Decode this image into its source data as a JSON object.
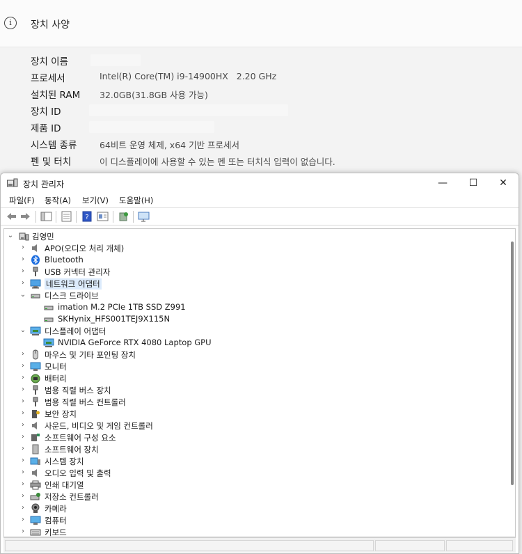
{
  "settings": {
    "spec_section_title": "장치 사양",
    "rows": [
      {
        "label": "장치 이름",
        "value": ""
      },
      {
        "label": "프로세서",
        "value": "Intel(R) Core(TM) i9-14900HX   2.20 GHz"
      },
      {
        "label": "설치된 RAM",
        "value": "32.0GB(31.8GB 사용 가능)"
      },
      {
        "label": "장치 ID",
        "value": ""
      },
      {
        "label": "제품 ID",
        "value": ""
      },
      {
        "label": "시스템 종류",
        "value": "64비트 운영 체제, x64 기반 프로세서"
      },
      {
        "label": "펜 및 터치",
        "value": "이 디스플레이에 사용할 수 있는 펜 또는 터치식 입력이 없습니다."
      }
    ]
  },
  "window": {
    "title": "장치 관리자",
    "minimize": "—",
    "maximize": "☐",
    "close": "✕"
  },
  "menu": [
    "파일(F)",
    "동작(A)",
    "보기(V)",
    "도움말(H)"
  ],
  "tree": {
    "root": "김영민",
    "expanded_chev": "⌄",
    "collapsed_chev": "›",
    "nodes": [
      {
        "label": "APO(오디오 처리 개체)",
        "icon": "speaker-icon"
      },
      {
        "label": "Bluetooth",
        "icon": "bluetooth-icon"
      },
      {
        "label": "USB 커넥터 관리자",
        "icon": "usb-icon"
      },
      {
        "label": "네트워크 어댑터",
        "icon": "network-adapter-icon",
        "selected": true
      },
      {
        "label": "디스크 드라이브",
        "icon": "disk-drive-icon",
        "expanded": true,
        "children": [
          "imation M.2 PCIe 1TB SSD Z991",
          "SKHynix_HFS001TEJ9X115N"
        ]
      },
      {
        "label": "디스플레이 어댑터",
        "icon": "display-adapter-icon",
        "expanded": true,
        "children": [
          "NVIDIA GeForce RTX 4080 Laptop GPU"
        ]
      },
      {
        "label": "마우스 및 기타 포인팅 장치",
        "icon": "mouse-icon"
      },
      {
        "label": "모니터",
        "icon": "monitor-icon"
      },
      {
        "label": "배터리",
        "icon": "battery-icon"
      },
      {
        "label": "범용 직렬 버스 장치",
        "icon": "usb-device-icon"
      },
      {
        "label": "범용 직렬 버스 컨트롤러",
        "icon": "usb-controller-icon"
      },
      {
        "label": "보안 장치",
        "icon": "security-device-icon"
      },
      {
        "label": "사운드, 비디오 및 게임 컨트롤러",
        "icon": "sound-icon"
      },
      {
        "label": "소프트웨어 구성 요소",
        "icon": "software-component-icon"
      },
      {
        "label": "소프트웨어 장치",
        "icon": "software-device-icon"
      },
      {
        "label": "시스템 장치",
        "icon": "system-device-icon"
      },
      {
        "label": "오디오 입력 및 출력",
        "icon": "audio-io-icon"
      },
      {
        "label": "인쇄 대기열",
        "icon": "print-queue-icon"
      },
      {
        "label": "저장소 컨트롤러",
        "icon": "storage-controller-icon"
      },
      {
        "label": "카메라",
        "icon": "camera-icon"
      },
      {
        "label": "컴퓨터",
        "icon": "computer-icon"
      },
      {
        "label": "키보드",
        "icon": "keyboard-icon"
      }
    ]
  }
}
